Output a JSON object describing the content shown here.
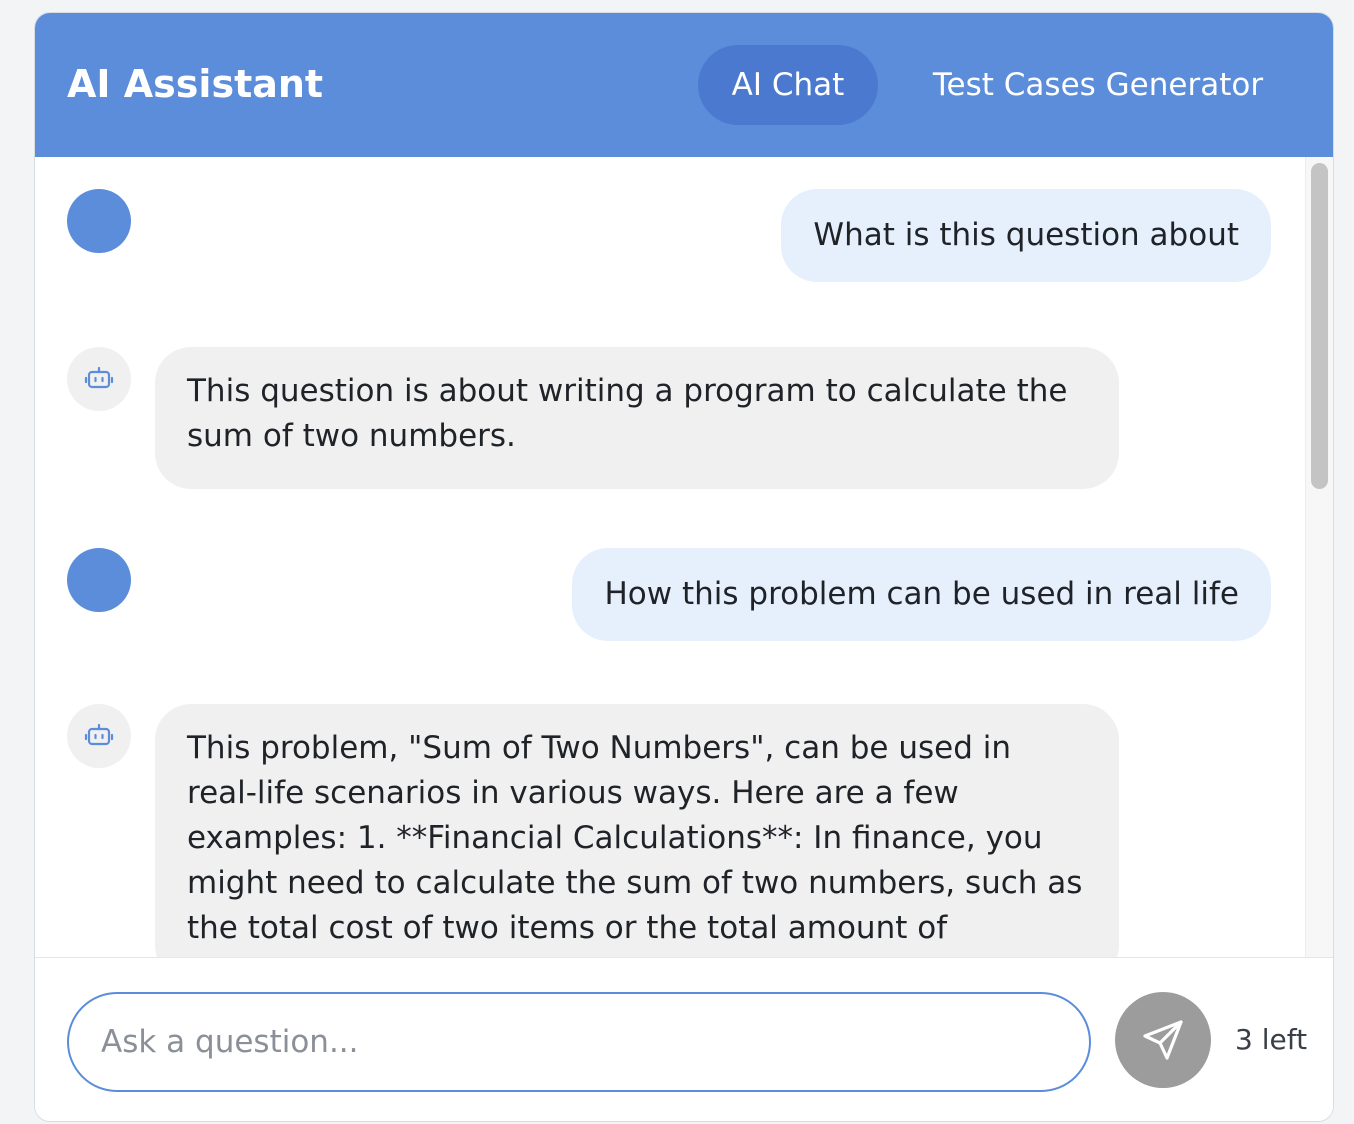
{
  "header": {
    "title": "AI Assistant",
    "tabs": [
      {
        "label": "AI Chat",
        "active": true
      },
      {
        "label": "Test Cases Generator",
        "active": false
      }
    ]
  },
  "messages": [
    {
      "role": "user",
      "text": "What is this question about"
    },
    {
      "role": "assistant",
      "icon": "robot-icon",
      "text": "This question is about writing a program to calculate the sum of two numbers."
    },
    {
      "role": "user",
      "text": "How this problem can be used in real life"
    },
    {
      "role": "assistant",
      "icon": "robot-icon",
      "text": "This problem, \"Sum of Two Numbers\", can be used in real-life scenarios in various ways. Here are a few examples: 1. **Financial Calculations**: In finance, you might need to calculate the sum of two numbers, such as the total cost of two items or the total amount of"
    }
  ],
  "composer": {
    "placeholder": "Ask a question...",
    "value": "",
    "send_icon": "send-icon",
    "remaining": "3 left"
  },
  "colors": {
    "accent": "#5b8ddb",
    "active_tab": "#4a79cf",
    "user_bubble": "#e6f0fd",
    "bot_bubble": "#f0f0f0",
    "send_button": "#9c9c9c"
  }
}
